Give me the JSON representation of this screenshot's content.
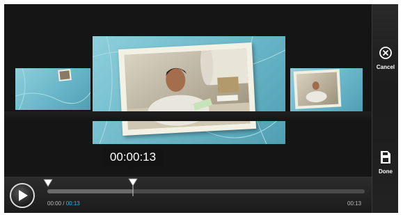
{
  "side_panel": {
    "cancel_label": "Cancel",
    "done_label": "Done",
    "cancel_icon": "close-circle-icon",
    "done_icon": "save-disk-icon"
  },
  "player": {
    "tooltip_time": "00:00:13",
    "current_time": "00:00",
    "separator": " / ",
    "trim_time": "00:13",
    "total_time": "00:13",
    "trim_position": 0.27
  },
  "colors": {
    "accent_time": "#33b5e5",
    "background": "#151515",
    "photo_blue": "#7cc6d6"
  },
  "icons": {
    "play": "play-icon",
    "start_marker": "trim-start-marker-icon",
    "end_marker": "trim-end-marker-icon"
  }
}
